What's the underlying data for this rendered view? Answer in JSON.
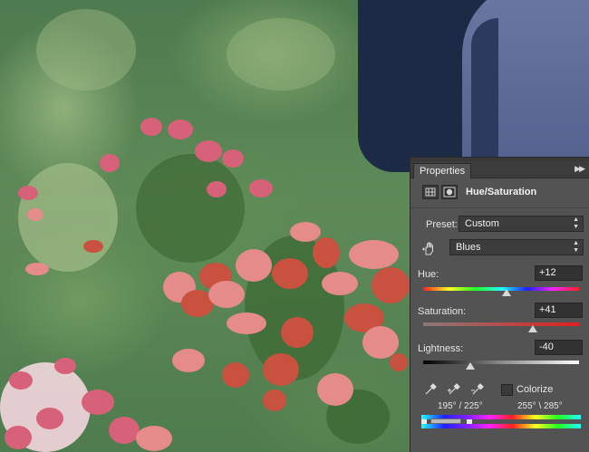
{
  "panel": {
    "tab_label": "Properties",
    "adjustment_title": "Hue/Saturation",
    "preset_label": "Preset:",
    "preset_value": "Custom",
    "channel_value": "Blues",
    "hue": {
      "label": "Hue:",
      "value": "+12",
      "level": 0.533
    },
    "saturation": {
      "label": "Saturation:",
      "value": "+41",
      "level": 0.705
    },
    "lightness": {
      "label": "Lightness:",
      "value": "-40",
      "level": 0.3
    },
    "colorize_label": "Colorize",
    "colorize_checked": false,
    "range_left": "195° / 225°",
    "range_right": "255° \\ 285°"
  },
  "icons": [
    "adjustment-layer-icon",
    "layer-mask-icon",
    "panel-menu-icon",
    "hand-target-icon",
    "eyedropper-icon",
    "eyedropper-plus-icon",
    "eyedropper-minus-icon",
    "select-arrows-icon"
  ],
  "colors": {
    "panel_bg": "#535353",
    "field_bg": "#3c3c3c",
    "text": "#e6e6e6"
  }
}
